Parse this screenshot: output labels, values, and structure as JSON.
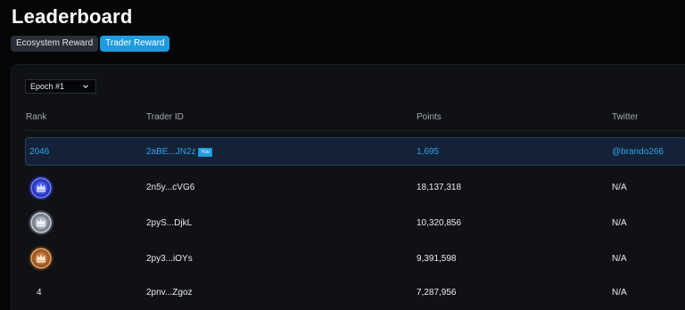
{
  "page": {
    "title": "Leaderboard"
  },
  "tabs": [
    {
      "label": "Ecosystem Reward",
      "active": false
    },
    {
      "label": "Trader Reward",
      "active": true
    }
  ],
  "epoch_select": {
    "value": "Epoch #1"
  },
  "table": {
    "columns": [
      "Rank",
      "Trader ID",
      "Points",
      "Twitter"
    ],
    "current_user": {
      "rank": "2046",
      "trader_id": "2aBE...JN2z",
      "badge": "You",
      "points": "1,695",
      "twitter": "@brando266"
    },
    "rows": [
      {
        "rank_icon": "gold-medal-icon",
        "trader_id": "2n5y...cVG6",
        "points": "18,137,318",
        "twitter": "N/A"
      },
      {
        "rank_icon": "silver-medal-icon",
        "trader_id": "2pyS...DjkL",
        "points": "10,320,856",
        "twitter": "N/A"
      },
      {
        "rank_icon": "bronze-medal-icon",
        "trader_id": "2py3...iOYs",
        "points": "9,391,598",
        "twitter": "N/A"
      },
      {
        "rank": "4",
        "trader_id": "2pnv...Zgoz",
        "points": "7,287,956",
        "twitter": "N/A"
      }
    ]
  },
  "colors": {
    "accent": "#1e9be0",
    "highlight_row": "#142238",
    "background": "#050608",
    "panel": "#0f1115"
  }
}
